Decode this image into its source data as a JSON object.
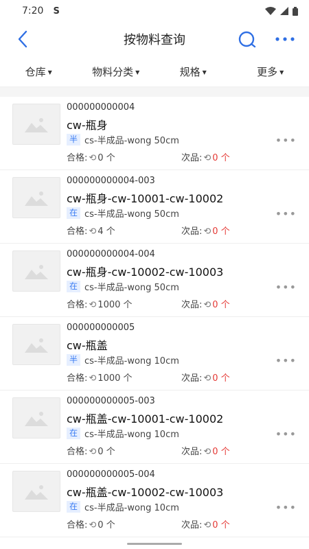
{
  "status": {
    "time": "7:20",
    "sync_icon": "S"
  },
  "nav": {
    "title": "按物料查询"
  },
  "filters": [
    {
      "label": "仓库"
    },
    {
      "label": "物料分类"
    },
    {
      "label": "规格"
    },
    {
      "label": "更多"
    }
  ],
  "qty_labels": {
    "good": "合格:",
    "defect": "次品:"
  },
  "items": [
    {
      "code": "000000000004",
      "name": "cw-瓶身",
      "badge": "半",
      "spec": "cs-半成品-wong  50cm",
      "good_qty": "0 个",
      "defect_qty": "0 个"
    },
    {
      "code": "000000000004-003",
      "name": "cw-瓶身-cw-10001-cw-10002",
      "badge": "在",
      "spec": "cs-半成品-wong  50cm",
      "good_qty": "4 个",
      "defect_qty": "0 个"
    },
    {
      "code": "000000000004-004",
      "name": "cw-瓶身-cw-10002-cw-10003",
      "badge": "在",
      "spec": "cs-半成品-wong  50cm",
      "good_qty": "1000 个",
      "defect_qty": "0 个"
    },
    {
      "code": "000000000005",
      "name": "cw-瓶盖",
      "badge": "半",
      "spec": "cs-半成品-wong  10cm",
      "good_qty": "1000 个",
      "defect_qty": "0 个"
    },
    {
      "code": "000000000005-003",
      "name": "cw-瓶盖-cw-10001-cw-10002",
      "badge": "在",
      "spec": "cs-半成品-wong  10cm",
      "good_qty": "0 个",
      "defect_qty": "0 个"
    },
    {
      "code": "000000000005-004",
      "name": "cw-瓶盖-cw-10002-cw-10003",
      "badge": "在",
      "spec": "cs-半成品-wong  10cm",
      "good_qty": "0 个",
      "defect_qty": "0 个"
    }
  ]
}
